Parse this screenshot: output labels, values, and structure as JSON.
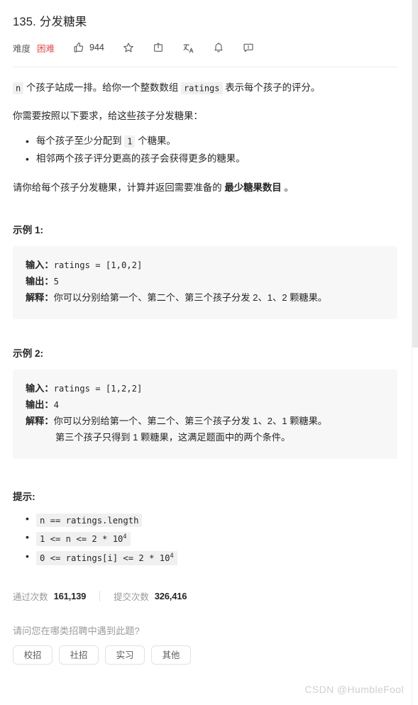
{
  "header": {
    "title": "135. 分发糖果",
    "difficulty_label": "难度",
    "difficulty_value": "困难",
    "difficulty_color": "#ef4743",
    "like_count": "944",
    "icons": {
      "like": "thumbs-up-icon",
      "favorite": "star-icon",
      "share": "share-icon",
      "translate": "translate-icon",
      "notify": "bell-icon",
      "feedback": "feedback-icon"
    }
  },
  "description": {
    "p1_code_n": "n",
    "p1_a": " 个孩子站成一排。给你一个整数数组 ",
    "p1_code_ratings": "ratings",
    "p1_b": " 表示每个孩子的评分。",
    "p2": "你需要按照以下要求，给这些孩子分发糖果：",
    "bullets": [
      {
        "a": "每个孩子至少分配到 ",
        "code": "1",
        "b": " 个糖果。"
      },
      {
        "a": "相邻两个孩子评分更高的孩子会获得更多的糖果。",
        "code": "",
        "b": ""
      }
    ],
    "p3_a": "请你给每个孩子分发糖果，计算并返回需要准备的 ",
    "p3_strong": "最少糖果数目",
    "p3_b": " 。"
  },
  "examples": [
    {
      "heading": "示例 1:",
      "input_key": "输入：",
      "input_value": "ratings = [1,0,2]",
      "output_key": "输出：",
      "output_value": "5",
      "explain_key": "解释：",
      "explain_value": "你可以分别给第一个、第二个、第三个孩子分发 2、1、2 颗糖果。",
      "extra_line": ""
    },
    {
      "heading": "示例 2:",
      "input_key": "输入：",
      "input_value": "ratings = [1,2,2]",
      "output_key": "输出：",
      "output_value": "4",
      "explain_key": "解释：",
      "explain_value": "你可以分别给第一个、第二个、第三个孩子分发 1、2、1 颗糖果。",
      "extra_line": "第三个孩子只得到 1 颗糖果，这满足题面中的两个条件。"
    }
  ],
  "hints": {
    "heading": "提示:",
    "items": [
      {
        "text": "n == ratings.length",
        "sup": ""
      },
      {
        "text": "1 <= n <= 2 * 10",
        "sup": "4"
      },
      {
        "text": "0 <= ratings[i] <= 2 * 10",
        "sup": "4"
      }
    ]
  },
  "stats": {
    "accepted_label": "通过次数",
    "accepted_value": "161,139",
    "submitted_label": "提交次数",
    "submitted_value": "326,416"
  },
  "survey": {
    "question": "请问您在哪类招聘中遇到此题?",
    "buttons": [
      "校招",
      "社招",
      "实习",
      "其他"
    ]
  },
  "watermark": "CSDN @HumbleFool",
  "scrollbar": {
    "thumb_color": "#e8e8e8"
  }
}
